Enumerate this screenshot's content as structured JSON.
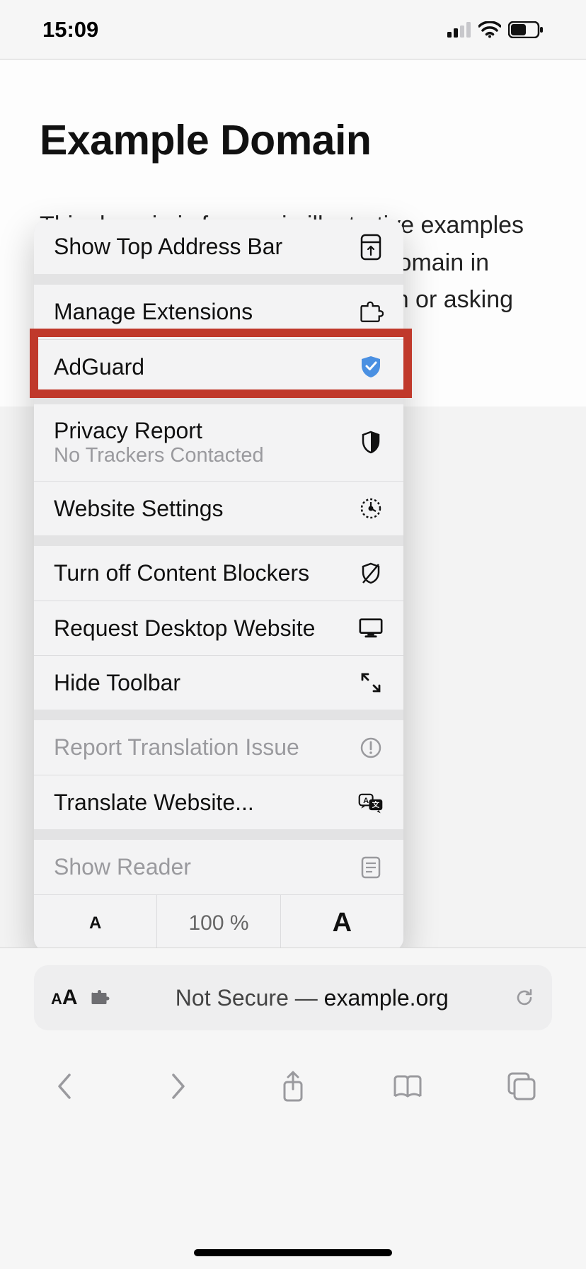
{
  "status_bar": {
    "time": "15:09"
  },
  "page": {
    "title": "Example Domain",
    "paragraph": "This domain is for use in illustrative examples in documents. You may use this domain in literature without prior coordination or asking for permission."
  },
  "menu": {
    "show_top": "Show Top Address Bar",
    "manage_ext": "Manage Extensions",
    "adguard": "AdGuard",
    "privacy": {
      "title": "Privacy Report",
      "sub": "No Trackers Contacted"
    },
    "website_settings": "Website Settings",
    "content_blockers": "Turn off Content Blockers",
    "request_desktop": "Request Desktop Website",
    "hide_toolbar": "Hide Toolbar",
    "report_translation": "Report Translation Issue",
    "translate": "Translate Website...",
    "show_reader": "Show Reader",
    "zoom": {
      "decrease": "A",
      "value": "100 %",
      "increase": "A"
    }
  },
  "address": {
    "security": "Not Secure — ",
    "host": "example.org"
  }
}
